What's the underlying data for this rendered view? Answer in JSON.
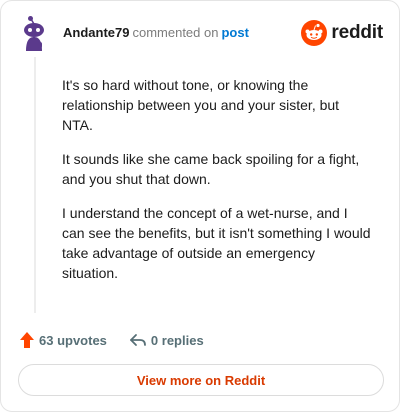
{
  "header": {
    "username": "Andante79",
    "action_text": "commented on",
    "post_link": "post",
    "brand": "reddit"
  },
  "comment": {
    "paragraphs": [
      "It's so hard without tone, or knowing the relationship between you and your sister, but NTA.",
      "It sounds like she came back spoiling for a fight, and you shut that down.",
      "I understand the concept of a wet-nurse, and I can see the benefits, but it isn't something I would take advantage of outside an emergency situation."
    ]
  },
  "actions": {
    "upvotes": "63 upvotes",
    "replies": "0 replies"
  },
  "footer": {
    "view_more": "View more on Reddit"
  },
  "colors": {
    "accent": "#ff4500",
    "link": "#0079d3",
    "view_more": "#d93a00",
    "avatar": "#5b3a8c"
  },
  "icons": {
    "avatar": "snoo-avatar-icon",
    "brand": "reddit-logo-icon",
    "upvote": "upvote-arrow-icon",
    "reply": "reply-arrow-icon"
  }
}
